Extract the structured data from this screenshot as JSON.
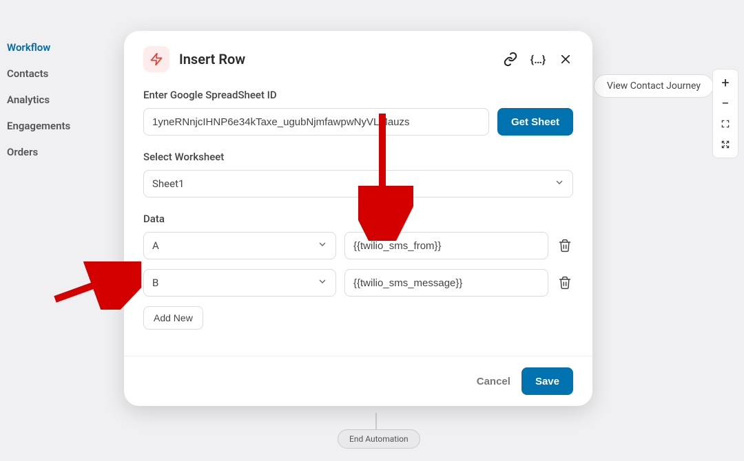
{
  "sidebar": {
    "items": [
      {
        "label": "Workflow",
        "active": true
      },
      {
        "label": "Contacts",
        "active": false
      },
      {
        "label": "Analytics",
        "active": false
      },
      {
        "label": "Engagements",
        "active": false
      },
      {
        "label": "Orders",
        "active": false
      }
    ]
  },
  "canvas": {
    "view_journey_label": "View Contact Journey",
    "end_node_label": "End Automation"
  },
  "modal": {
    "title": "Insert Row",
    "spreadsheet_label": "Enter Google SpreadSheet ID",
    "spreadsheet_value": "1yneRNnjcIHNP6e34kTaxe_ugubNjmfawpwNyVLMauzs",
    "get_sheet_label": "Get Sheet",
    "worksheet_label": "Select Worksheet",
    "worksheet_value": "Sheet1",
    "data_label": "Data",
    "rows": [
      {
        "col": "A",
        "value": "{{twilio_sms_from}}"
      },
      {
        "col": "B",
        "value": "{{twilio_sms_message}}"
      }
    ],
    "add_new_label": "Add New",
    "cancel_label": "Cancel",
    "save_label": "Save"
  }
}
